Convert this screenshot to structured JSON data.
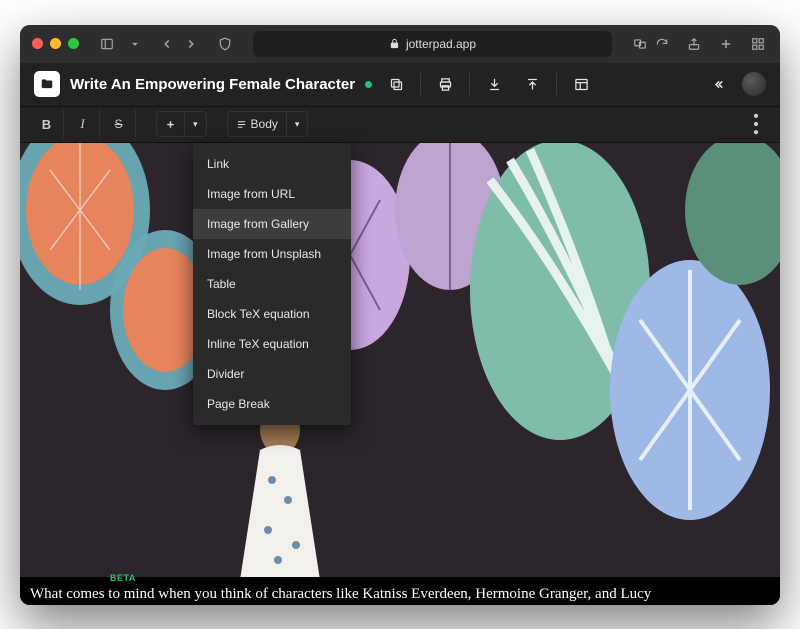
{
  "browser": {
    "url": "jotterpad.app"
  },
  "header": {
    "doc_title": "Write An Empowering Female Character"
  },
  "toolbar": {
    "style_label": "Body"
  },
  "insert_menu": {
    "items": [
      "Link",
      "Image from URL",
      "Image from Gallery",
      "Image from Unsplash",
      "Table",
      "Block TeX equation",
      "Inline TeX equation",
      "Divider",
      "Page Break"
    ],
    "highlighted_index": 2
  },
  "editor": {
    "beta_label": "BETA",
    "body_preview": "What comes to mind when you think of characters like Katniss Everdeen, Hermoine Granger, and Lucy"
  }
}
